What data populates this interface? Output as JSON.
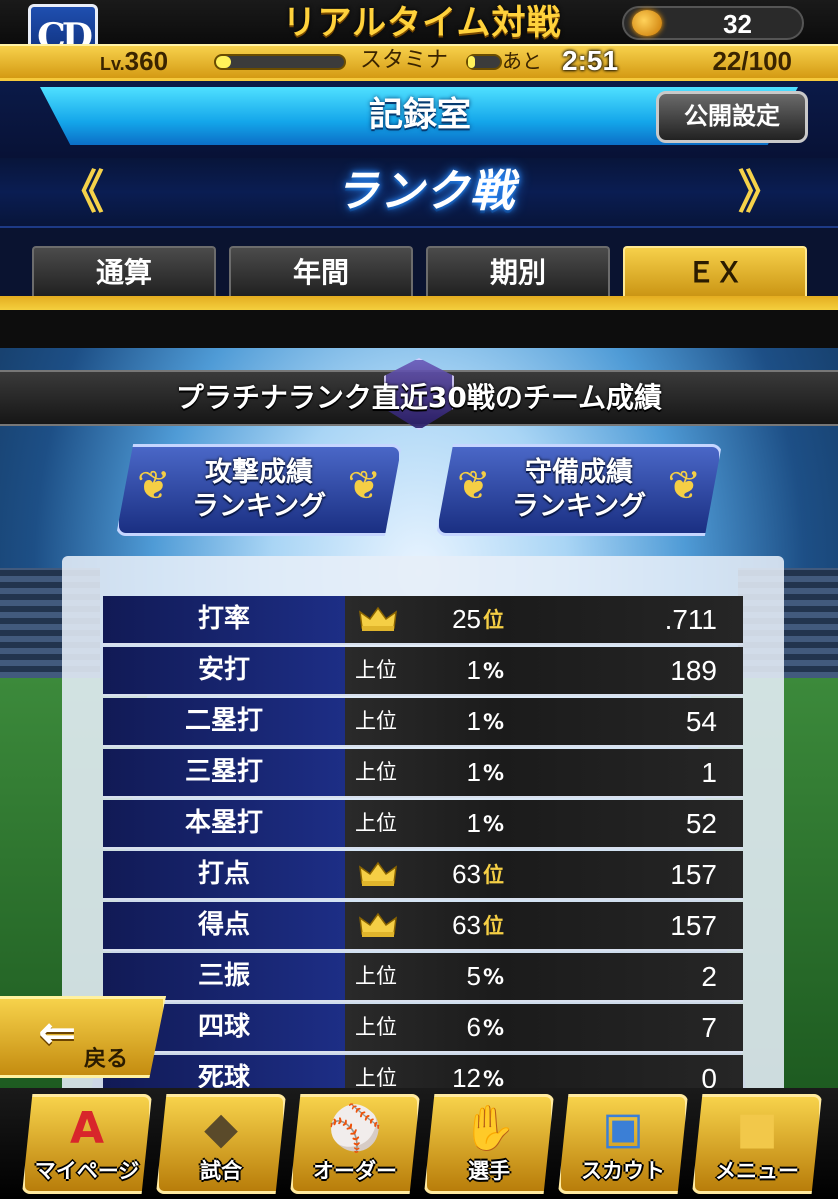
{
  "header": {
    "team_logo_text": "CD",
    "mode_title": "リアルタイム対戦",
    "coin_count": "32",
    "level_prefix": "Lv.",
    "level": "360",
    "stamina_label": "スタミナ",
    "remain_label": "あと",
    "remain_time": "2:51",
    "stamina_value": "22/100",
    "stamina_fraction": 0.22,
    "exp_fraction": 0.12
  },
  "screen": {
    "title": "記録室",
    "public_settings_label": "公開設定",
    "mode_logo": "ランク戦",
    "prev_arrow": "《",
    "next_arrow": "》"
  },
  "tabs": [
    {
      "label": "通算",
      "active": false
    },
    {
      "label": "年間",
      "active": false
    },
    {
      "label": "期別",
      "active": false
    },
    {
      "label": "ＥＸ",
      "active": true
    }
  ],
  "section": {
    "title": "プラチナランク直近30戦のチーム成績",
    "attack_ranking": [
      "攻撃成績",
      "ランキング"
    ],
    "defense_ranking": [
      "守備成績",
      "ランキング"
    ]
  },
  "stats": [
    {
      "label": "打率",
      "rank_type": "crown",
      "prefix": "",
      "rank": "25",
      "unit": "位",
      "value": ".711"
    },
    {
      "label": "安打",
      "rank_type": "top",
      "prefix": "上位",
      "rank": "1",
      "unit": "%",
      "value": "189"
    },
    {
      "label": "二塁打",
      "rank_type": "top",
      "prefix": "上位",
      "rank": "1",
      "unit": "%",
      "value": "54"
    },
    {
      "label": "三塁打",
      "rank_type": "top",
      "prefix": "上位",
      "rank": "1",
      "unit": "%",
      "value": "1"
    },
    {
      "label": "本塁打",
      "rank_type": "top",
      "prefix": "上位",
      "rank": "1",
      "unit": "%",
      "value": "52"
    },
    {
      "label": "打点",
      "rank_type": "crown",
      "prefix": "",
      "rank": "63",
      "unit": "位",
      "value": "157"
    },
    {
      "label": "得点",
      "rank_type": "crown",
      "prefix": "",
      "rank": "63",
      "unit": "位",
      "value": "157"
    },
    {
      "label": "三振",
      "rank_type": "top",
      "prefix": "上位",
      "rank": "5",
      "unit": "%",
      "value": "2"
    },
    {
      "label": "四球",
      "rank_type": "top",
      "prefix": "上位",
      "rank": "6",
      "unit": "%",
      "value": "7"
    },
    {
      "label": "死球",
      "rank_type": "top",
      "prefix": "上位",
      "rank": "12",
      "unit": "%",
      "value": "0"
    }
  ],
  "back": {
    "label": "戻る"
  },
  "nav": [
    {
      "label": "マイページ",
      "icon": "A",
      "icon_color": "#d8262b"
    },
    {
      "label": "試合",
      "icon": "◆",
      "icon_color": "#5a4a2a"
    },
    {
      "label": "オーダー",
      "icon": "⚾",
      "icon_color": "#ffffff"
    },
    {
      "label": "選手",
      "icon": "✋",
      "icon_color": "#b7f23a"
    },
    {
      "label": "スカウト",
      "icon": "▣",
      "icon_color": "#3b7fd6"
    },
    {
      "label": "メニュー",
      "icon": "■",
      "icon_color": "#f2c84a"
    }
  ]
}
